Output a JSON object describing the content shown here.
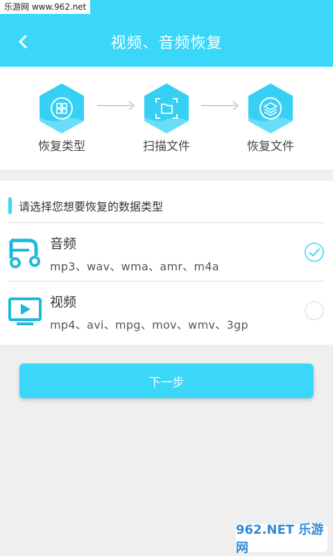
{
  "watermark": {
    "top_text": "乐游网 www.962.net",
    "bottom_text": "962.NET 乐游网"
  },
  "header": {
    "title": "视频、音频恢复",
    "back_icon": "chevron-left-icon"
  },
  "steps": [
    {
      "label": "恢复类型",
      "icon": "grid-icon"
    },
    {
      "label": "扫描文件",
      "icon": "scan-file-icon"
    },
    {
      "label": "恢复文件",
      "icon": "layers-icon"
    }
  ],
  "section": {
    "title": "请选择您想要恢复的数据类型"
  },
  "options": [
    {
      "name": "音频",
      "formats": "mp3、wav、wma、amr、m4a",
      "selected": true,
      "icon": "audio-icon"
    },
    {
      "name": "视频",
      "formats": "mp4、avi、mpg、mov、wmv、3gp",
      "selected": false,
      "icon": "video-icon"
    }
  ],
  "next_button": {
    "label": "下一步"
  },
  "colors": {
    "accent": "#3ad7f8",
    "step_hex": "#35d0f4",
    "check": "#3ad7f8",
    "background": "#efefef"
  }
}
